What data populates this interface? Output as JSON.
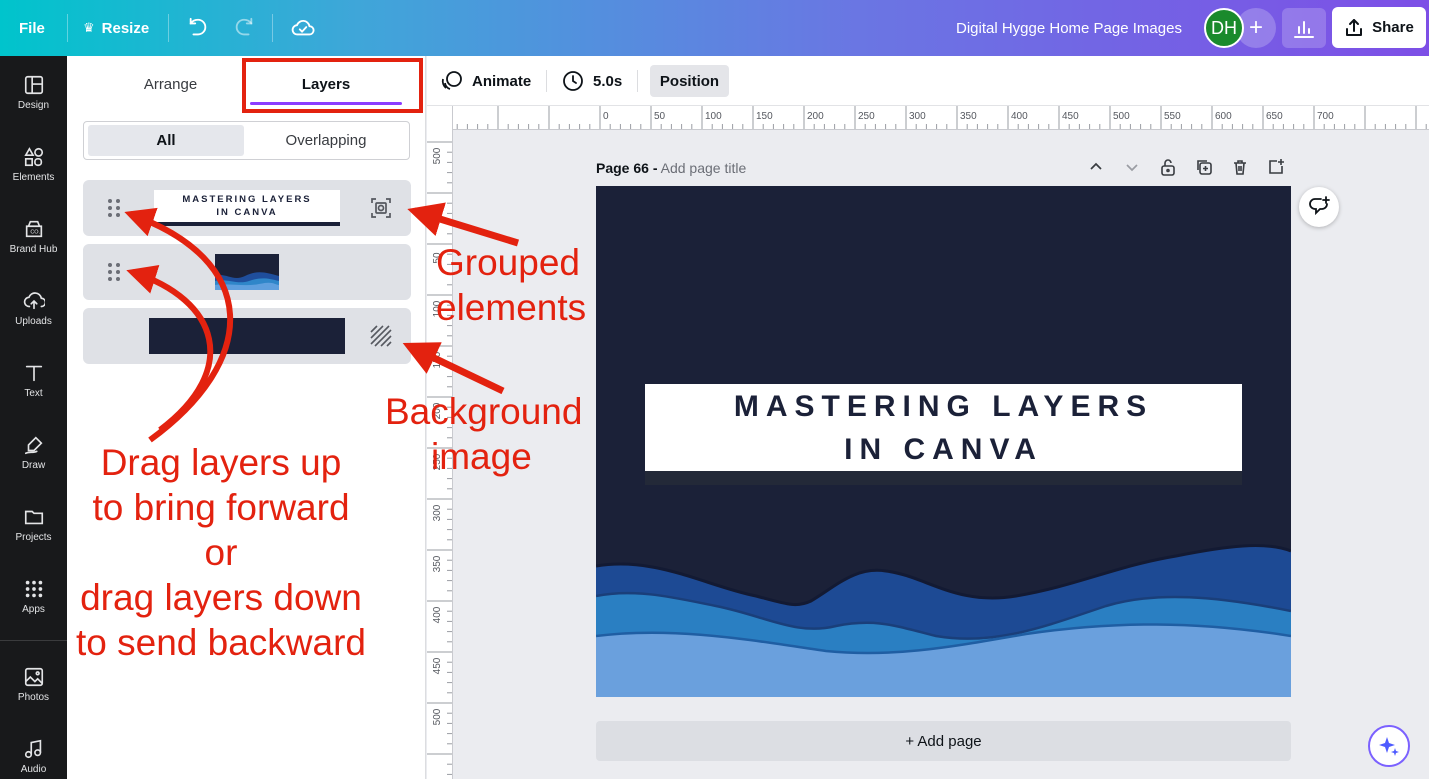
{
  "topbar": {
    "file_label": "File",
    "resize_label": "Resize",
    "doc_title": "Digital Hygge Home Page Images",
    "avatar_initials": "DH",
    "avatar_add_label": "+",
    "share_label": "Share"
  },
  "rail": {
    "items": [
      {
        "label": "Design",
        "icon": "design-icon"
      },
      {
        "label": "Elements",
        "icon": "elements-icon"
      },
      {
        "label": "Brand Hub",
        "icon": "brand-hub-icon"
      },
      {
        "label": "Uploads",
        "icon": "uploads-icon"
      },
      {
        "label": "Text",
        "icon": "text-icon"
      },
      {
        "label": "Draw",
        "icon": "draw-icon"
      },
      {
        "label": "Projects",
        "icon": "projects-icon"
      },
      {
        "label": "Apps",
        "icon": "apps-icon"
      },
      {
        "label": "Photos",
        "icon": "photos-icon"
      },
      {
        "label": "Audio",
        "icon": "audio-icon"
      }
    ]
  },
  "panel": {
    "tabs": [
      "Arrange",
      "Layers"
    ],
    "active_tab": "Layers",
    "filter": {
      "all": "All",
      "overlapping": "Overlapping"
    },
    "layers": [
      {
        "thumb_text_line1": "MASTERING LAYERS",
        "thumb_text_line2": "IN CANVA",
        "badge_icon": "group-icon"
      },
      {
        "thumb": "wave-image"
      },
      {
        "thumb": "background-image",
        "badge_icon": "background-hatch-icon"
      }
    ]
  },
  "toolbar2": {
    "animate_label": "Animate",
    "duration_label": "5.0s",
    "position_label": "Position"
  },
  "rulers": {
    "h_ticks": [
      "0",
      "50",
      "100",
      "150",
      "200",
      "250",
      "300",
      "350",
      "400",
      "450",
      "500",
      "550",
      "600",
      "650",
      "700"
    ],
    "v_ticks": [
      "500",
      "0",
      "50",
      "100",
      "150",
      "200",
      "250",
      "300",
      "350",
      "400",
      "450",
      "500"
    ]
  },
  "page": {
    "label": "Page 66 -",
    "title_placeholder": "Add page title",
    "design_title_line1": "MASTERING LAYERS",
    "design_title_line2": "IN CANVA",
    "add_page_label": "+ Add page"
  },
  "annotations": {
    "grouped_line1": "Grouped",
    "grouped_line2": "elements",
    "background_line1": "Background",
    "background_line2": "image",
    "drag_line1": "Drag layers up",
    "drag_line2": "to bring forward",
    "drag_line3": "or",
    "drag_line4": "drag layers down",
    "drag_line5": "to send backward"
  },
  "colors": {
    "accent_purple": "#8b3dff",
    "annotation_red": "#e3220f",
    "design_navy": "#1b2138"
  }
}
